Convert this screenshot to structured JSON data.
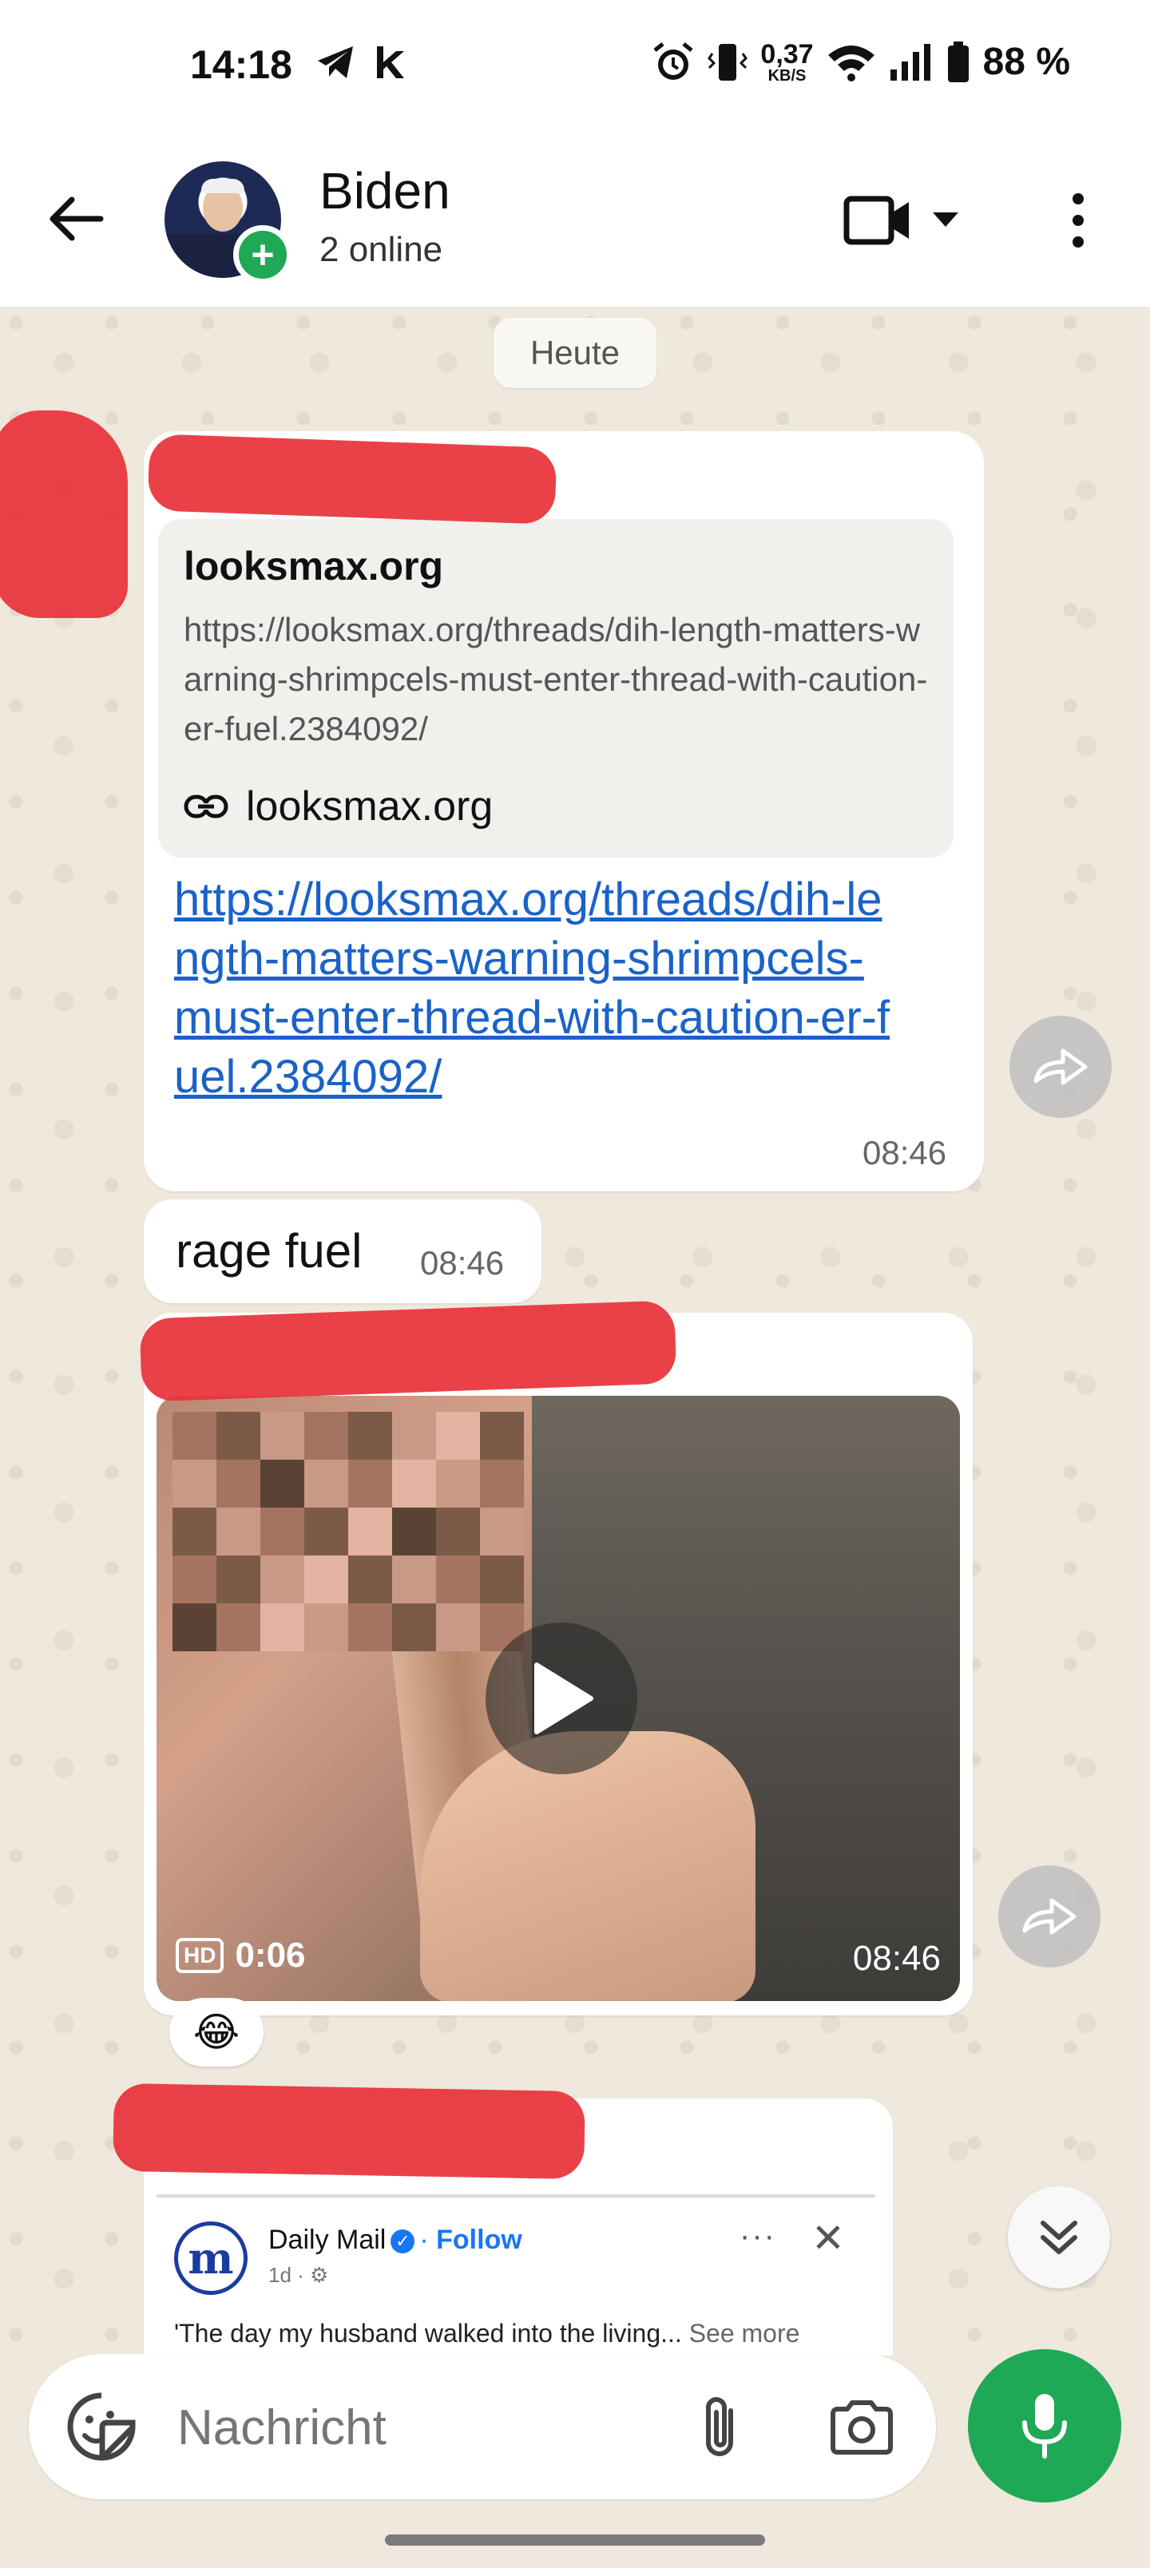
{
  "status_bar": {
    "time": "14:18",
    "left_icons": [
      "telegram-icon",
      "k-icon"
    ],
    "net_speed_value": "0,37",
    "net_speed_unit": "KB/S",
    "battery_percent": "88 %"
  },
  "header": {
    "contact_name": "Biden",
    "subtitle": "2 online"
  },
  "chat": {
    "date_chip": "Heute",
    "messages": [
      {
        "link_preview": {
          "title": "looksmax.org",
          "description": "https://looksmax.org/threads/dih-length-matters-warning-shrimpcels-must-enter-thread-with-caution-er-fuel.2384092/",
          "domain": "looksmax.org"
        },
        "link": "https://looksmax.org/threads/dih-length-matters-warning-shrimpcels-must-enter-thread-with-caution-er-fuel.2384092/",
        "time": "08:46"
      },
      {
        "text": "rage fuel",
        "time": "08:46"
      },
      {
        "video_duration": "0:06",
        "hd_label": "HD",
        "time": "08:46",
        "reaction": "😂"
      },
      {
        "embedded_post": {
          "logo_letter": "m",
          "source": "Daily Mail",
          "follow": "Follow",
          "age": "1d ·",
          "text": "'The day my husband walked into the living...",
          "see_more": "See more"
        }
      }
    ]
  },
  "composer": {
    "placeholder": "Nachricht"
  },
  "colors": {
    "accent_green": "#1fa855",
    "link_blue": "#1a62c9",
    "chat_bg": "#efe8dc",
    "redaction_red": "#e8333b"
  }
}
